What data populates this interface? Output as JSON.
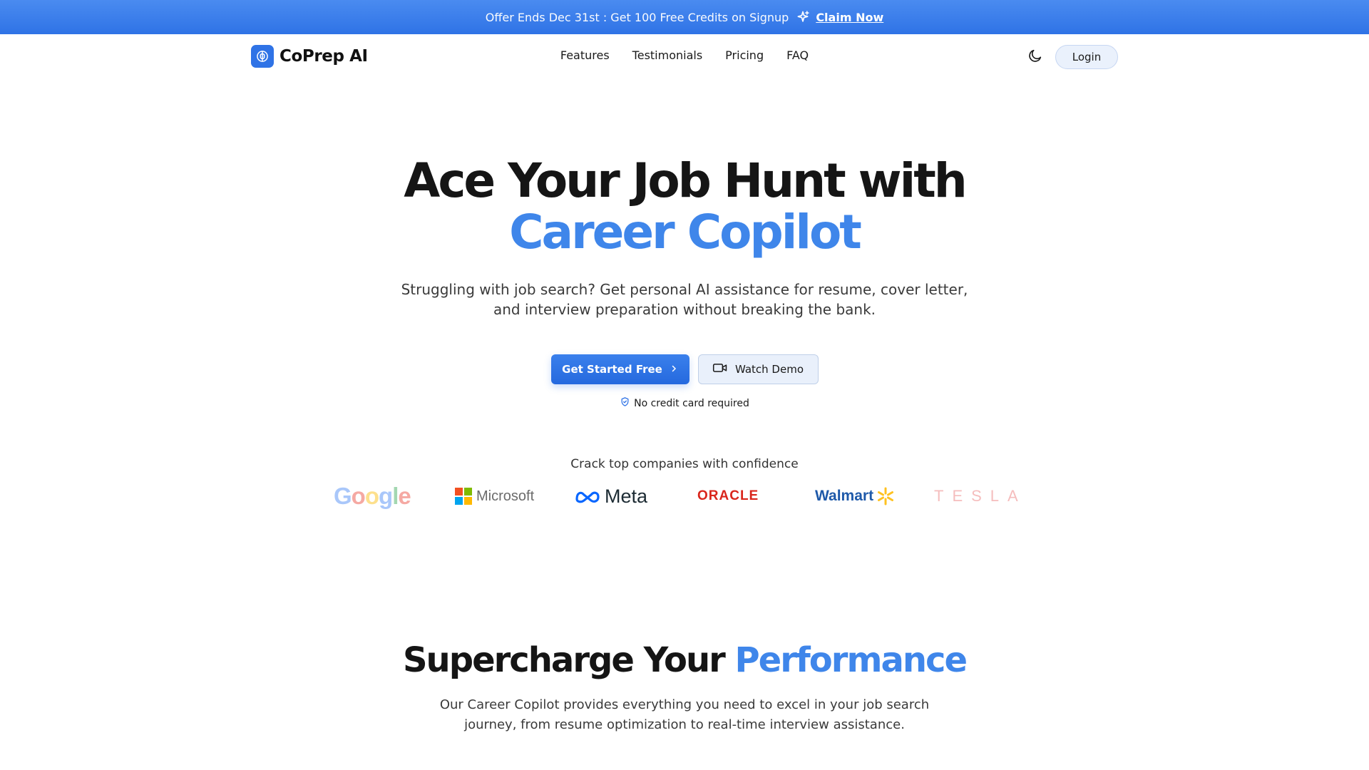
{
  "banner": {
    "offer_text": "Offer Ends Dec 31st : Get 100 Free Credits on Signup",
    "claim_label": "Claim Now"
  },
  "nav": {
    "brand": "CoPrep AI",
    "links": [
      "Features",
      "Testimonials",
      "Pricing",
      "FAQ"
    ],
    "login_label": "Login",
    "theme_icon": "moon-icon"
  },
  "hero": {
    "title_line1": "Ace Your Job Hunt with",
    "title_line2": "Career Copilot",
    "subtitle": "Struggling with job search? Get personal AI assistance for resume, cover letter, and interview preparation without breaking the bank.",
    "primary_cta": "Get Started Free",
    "secondary_cta": "Watch Demo",
    "note": "No credit card required"
  },
  "companies": {
    "title": "Crack top companies with confidence",
    "logos": [
      "Google",
      "Microsoft",
      "Meta",
      "ORACLE",
      "Walmart",
      "TESLA"
    ]
  },
  "features_section": {
    "title_part1": "Supercharge Your",
    "title_part2": "Performance",
    "subtitle": "Our Career Copilot provides everything you need to excel in your job search journey, from resume optimization to real-time interview assistance."
  },
  "colors": {
    "accent": "#3f86ea",
    "banner": "#2f73e6",
    "primary_button": "#2569de"
  }
}
